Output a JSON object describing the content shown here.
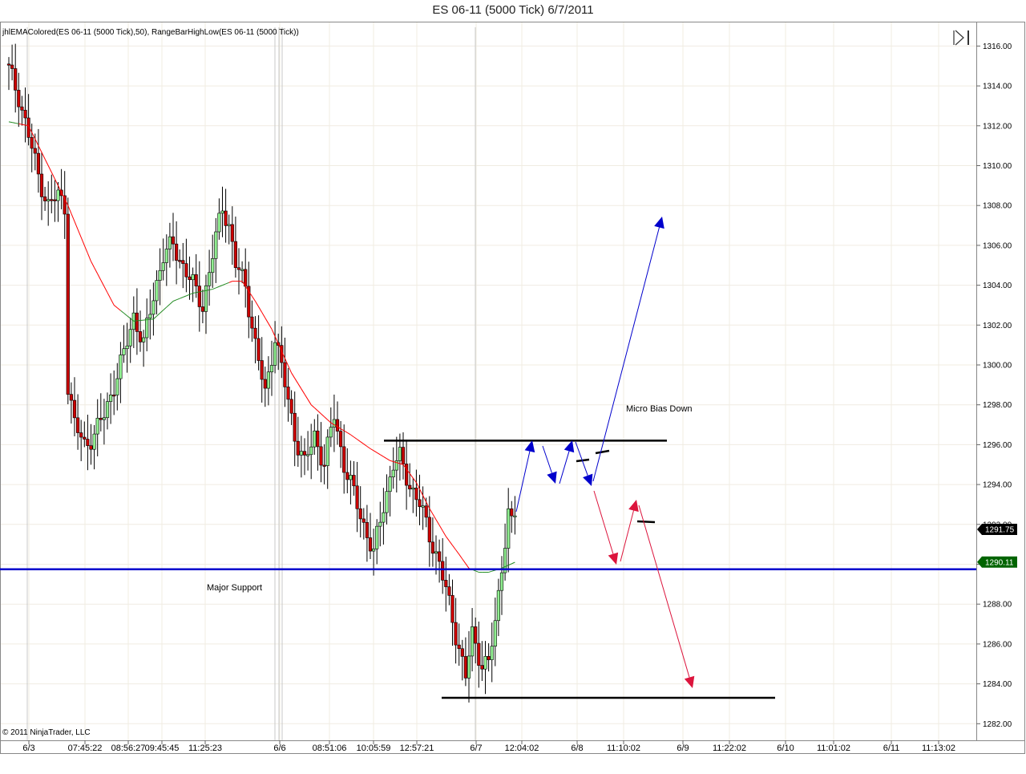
{
  "window": {
    "title": "ES 06-11 (5000 Tick)  6/7/2011"
  },
  "indicator_label": "jhlEMAColored(ES 06-11 (5000 Tick),50), RangeBarHighLow(ES 06-11 (5000 Tick))",
  "copyright": "© 2011 NinjaTrader, LLC",
  "annotations": {
    "micro_bias": "Micro Bias Down",
    "major_support": "Major Support"
  },
  "price_tags": {
    "last": "1291.75",
    "level": "1290.11"
  },
  "icons": {
    "scroll_end": "scroll-to-end-icon"
  },
  "colors": {
    "up": "#90ee90",
    "down": "#cc0000",
    "ema_down": "#ff0000",
    "ema_up": "#228b22",
    "support": "#0000cc",
    "blue_arrow": "#0000cc",
    "red_arrow": "#dc143c",
    "last_tag": "#000000",
    "level_tag": "#006400"
  },
  "chart_data": {
    "type": "candlestick",
    "title": "ES 06-11 (5000 Tick)  6/7/2011",
    "ylim": [
      1281.5,
      1316.8
    ],
    "y_ticks": [
      "1282.00",
      "1284.00",
      "1286.00",
      "1288.00",
      "1290.00",
      "1292.00",
      "1294.00",
      "1296.00",
      "1298.00",
      "1300.00",
      "1302.00",
      "1304.00",
      "1306.00",
      "1308.00",
      "1310.00",
      "1312.00",
      "1314.00",
      "1316.00"
    ],
    "x_ticks": [
      "6/3",
      "07:45:22",
      "08:56:27",
      "09:45:45",
      "11:25:23",
      "6/6",
      "08:51:06",
      "10:05:59",
      "12:57:21",
      "6/7",
      "12:04:02",
      "6/8",
      "11:10:02",
      "6/9",
      "11:22:02",
      "6/10",
      "11:01:02",
      "6/11",
      "11:13:02"
    ],
    "bar_count": 155,
    "close_path": [
      [
        0,
        1314.8
      ],
      [
        3,
        1313.5
      ],
      [
        6,
        1311.5
      ],
      [
        9,
        1309.5
      ],
      [
        12,
        1308
      ],
      [
        15,
        1308.5
      ],
      [
        17,
        1308
      ],
      [
        18,
        1299
      ],
      [
        20,
        1297
      ],
      [
        23,
        1296
      ],
      [
        26,
        1296.5
      ],
      [
        29,
        1297.5
      ],
      [
        32,
        1299
      ],
      [
        35,
        1300.5
      ],
      [
        38,
        1302.5
      ],
      [
        41,
        1301
      ],
      [
        44,
        1303.5
      ],
      [
        47,
        1305.5
      ],
      [
        50,
        1306
      ],
      [
        53,
        1305
      ],
      [
        56,
        1304
      ],
      [
        59,
        1303
      ],
      [
        62,
        1305.5
      ],
      [
        65,
        1308
      ],
      [
        67,
        1307
      ],
      [
        69,
        1305
      ],
      [
        72,
        1304
      ],
      [
        75,
        1301
      ],
      [
        78,
        1298.5
      ],
      [
        81,
        1301.5
      ],
      [
        84,
        1299
      ],
      [
        87,
        1296.5
      ],
      [
        90,
        1295
      ],
      [
        93,
        1296.5
      ],
      [
        96,
        1295
      ],
      [
        99,
        1297.5
      ],
      [
        102,
        1295
      ],
      [
        105,
        1293.5
      ],
      [
        108,
        1292
      ],
      [
        111,
        1290.5
      ],
      [
        114,
        1293
      ],
      [
        117,
        1295
      ],
      [
        119,
        1295.3
      ],
      [
        122,
        1294
      ],
      [
        125,
        1293
      ],
      [
        128,
        1291.5
      ],
      [
        131,
        1290
      ],
      [
        134,
        1288
      ],
      [
        137,
        1285.8
      ],
      [
        139,
        1284.3
      ],
      [
        141,
        1286.5
      ],
      [
        144,
        1285
      ],
      [
        146,
        1285
      ],
      [
        148,
        1287
      ],
      [
        150,
        1290
      ],
      [
        152,
        1292.5
      ],
      [
        153,
        1292
      ],
      [
        154,
        1292.5
      ]
    ],
    "ema50_path": [
      [
        0,
        1312.2
      ],
      [
        6,
        1312
      ],
      [
        12,
        1310
      ],
      [
        18,
        1308
      ],
      [
        25,
        1305.2
      ],
      [
        32,
        1303
      ],
      [
        38,
        1302.2
      ],
      [
        44,
        1302.3
      ],
      [
        50,
        1303.2
      ],
      [
        56,
        1303.6
      ],
      [
        62,
        1303.8
      ],
      [
        68,
        1304.2
      ],
      [
        71,
        1304.2
      ],
      [
        75,
        1303.2
      ],
      [
        80,
        1301.8
      ],
      [
        86,
        1299.6
      ],
      [
        92,
        1298
      ],
      [
        98,
        1297.1
      ],
      [
        104,
        1296.5
      ],
      [
        110,
        1295.8
      ],
      [
        116,
        1295.2
      ],
      [
        120,
        1295
      ],
      [
        124,
        1294.1
      ],
      [
        128,
        1292.8
      ],
      [
        133,
        1291.4
      ],
      [
        137,
        1290.5
      ],
      [
        140,
        1289.8
      ],
      [
        143,
        1289.6
      ],
      [
        146,
        1289.6
      ],
      [
        150,
        1289.8
      ],
      [
        154,
        1290.1
      ]
    ],
    "ema_up_ranges": [
      [
        0,
        2
      ],
      [
        34,
        66
      ],
      [
        141,
        154
      ]
    ],
    "support_level": 1289.75,
    "range_high": 1296.2,
    "range_low": 1283.3,
    "last_price": 1291.75,
    "level_price": 1290.11
  }
}
